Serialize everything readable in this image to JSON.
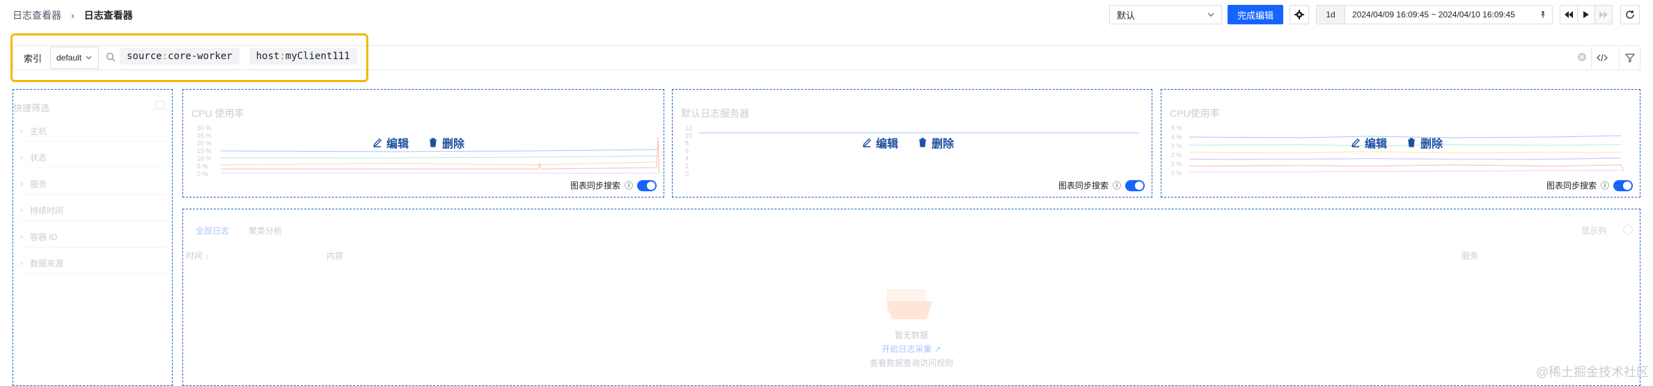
{
  "breadcrumb": {
    "parent": "日志查看器",
    "current": "日志查看器"
  },
  "toolbar": {
    "layout_value": "默认",
    "done_label": "完成编辑",
    "time_range_short": "1d",
    "time_range": "2024/04/09 16:09:45 ~ 2024/04/10 16:09:45"
  },
  "search": {
    "index_label": "索引",
    "index_value": "default",
    "tokens": [
      {
        "key": "source",
        "value": "core-worker"
      },
      {
        "key": "host",
        "value": "myClient111"
      }
    ]
  },
  "sidebar": {
    "title": "快捷筛选",
    "items": [
      "主机",
      "状态",
      "服务",
      "持续时间",
      "容器 ID",
      "数据来源"
    ]
  },
  "panels": [
    {
      "title": "CPU 使用率",
      "edit": "编辑",
      "delete": "删除",
      "sync": "图表同步搜索",
      "yticks": [
        "30 %",
        "25 %",
        "20 %",
        "15 %",
        "10 %",
        "5 %",
        "0 %"
      ]
    },
    {
      "title": "默认日志服务器",
      "edit": "编辑",
      "delete": "删除",
      "sync": "图表同步搜索",
      "yticks": [
        "12",
        "10",
        "8",
        "6",
        "4",
        "2",
        "0"
      ]
    },
    {
      "title": "CPU使用率",
      "edit": "编辑",
      "delete": "删除",
      "sync": "图表同步搜索",
      "yticks": [
        "5 %",
        "4 %",
        "3 %",
        "2 %",
        "1 %",
        "0 %"
      ]
    }
  ],
  "logs": {
    "tabs": [
      "全部日志",
      "聚类分析"
    ],
    "show_columns": "显示列",
    "columns": {
      "time": "时间",
      "content": "内容",
      "service": "服务"
    },
    "empty_text": "暂无数据",
    "enable_link": "开启日志采集",
    "hint": "查看数据查询访问规则"
  },
  "watermark": "@稀土掘金技术社区",
  "colors": {
    "accent": "#1664ff",
    "highlight": "#f5b800",
    "panel_border": "#1f5fbf"
  }
}
